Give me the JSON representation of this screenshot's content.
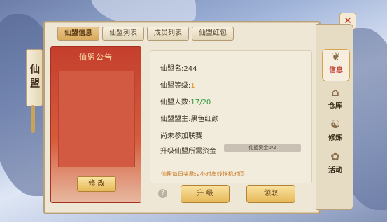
{
  "tabs": [
    {
      "label": "仙盟信息",
      "active": true
    },
    {
      "label": "仙盟列表",
      "active": false
    },
    {
      "label": "成员列表",
      "active": false
    },
    {
      "label": "仙盟红包",
      "active": false
    }
  ],
  "scroll_title": "仙盟",
  "notice": {
    "title": "仙盟公告",
    "edit_label": "修 改"
  },
  "info": {
    "name_label": "仙盟名:",
    "name_value": "244",
    "level_label": "仙盟等级:",
    "level_value": "1",
    "members_label": "仙盟人数:",
    "members_value": "17/20",
    "leader_label": "仙盟盟主:",
    "leader_value": "黑色红颜",
    "league_status": "尚未参加联赛",
    "fund_label": "升级仙盟所需资金",
    "fund_bar_text": "仙盟资金0/2",
    "fund_progress": 0
  },
  "daily_reward": "仙盟每日奖励:2小时离线挂机时间",
  "buttons": {
    "upgrade": "升 级",
    "claim": "领取",
    "help": "?",
    "close": "✕"
  },
  "side_tabs": [
    {
      "label": "信息",
      "icon": "info-scroll-icon",
      "active": true
    },
    {
      "label": "仓库",
      "icon": "warehouse-icon",
      "active": false
    },
    {
      "label": "修炼",
      "icon": "cultivation-icon",
      "active": false
    },
    {
      "label": "活动",
      "icon": "activity-icon",
      "active": false
    }
  ]
}
